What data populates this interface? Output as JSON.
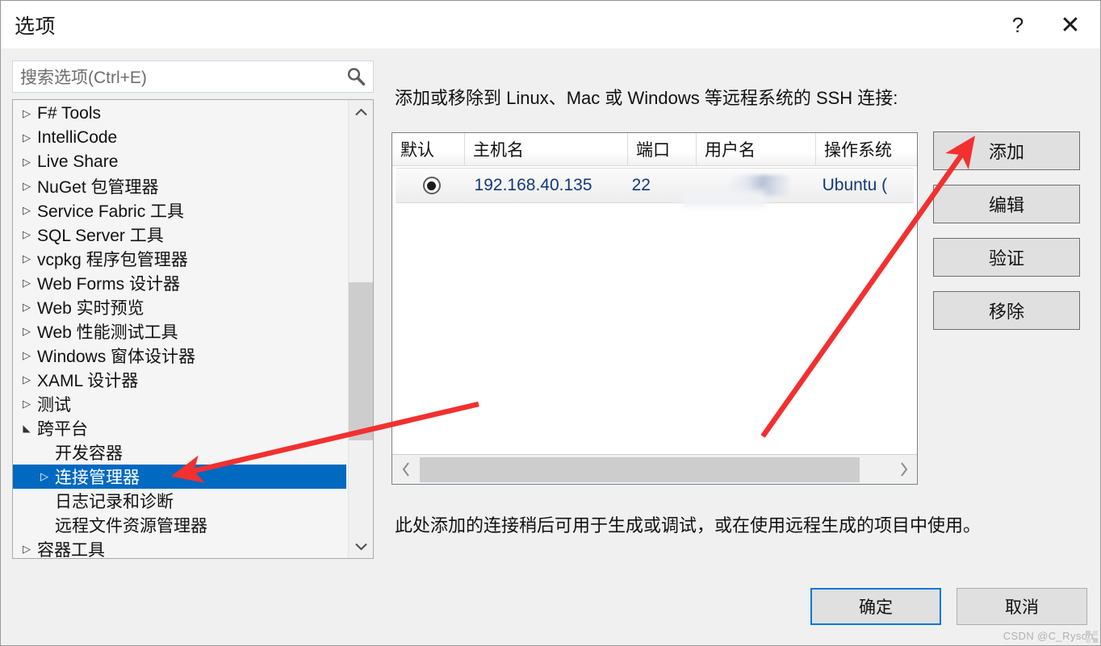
{
  "window": {
    "title": "选项",
    "help_label": "?",
    "close_label": "✕"
  },
  "search": {
    "placeholder": "搜索选项(Ctrl+E)",
    "icon": "search-icon"
  },
  "tree": {
    "items": [
      {
        "label": "F# Tools",
        "expandable": true,
        "expanded": false,
        "level": 0,
        "selected": false
      },
      {
        "label": "IntelliCode",
        "expandable": true,
        "expanded": false,
        "level": 0,
        "selected": false
      },
      {
        "label": "Live Share",
        "expandable": true,
        "expanded": false,
        "level": 0,
        "selected": false
      },
      {
        "label": "NuGet 包管理器",
        "expandable": true,
        "expanded": false,
        "level": 0,
        "selected": false
      },
      {
        "label": "Service Fabric 工具",
        "expandable": true,
        "expanded": false,
        "level": 0,
        "selected": false
      },
      {
        "label": "SQL Server 工具",
        "expandable": true,
        "expanded": false,
        "level": 0,
        "selected": false
      },
      {
        "label": "vcpkg 程序包管理器",
        "expandable": true,
        "expanded": false,
        "level": 0,
        "selected": false
      },
      {
        "label": "Web Forms 设计器",
        "expandable": true,
        "expanded": false,
        "level": 0,
        "selected": false
      },
      {
        "label": "Web 实时预览",
        "expandable": true,
        "expanded": false,
        "level": 0,
        "selected": false
      },
      {
        "label": "Web 性能测试工具",
        "expandable": true,
        "expanded": false,
        "level": 0,
        "selected": false
      },
      {
        "label": "Windows 窗体设计器",
        "expandable": true,
        "expanded": false,
        "level": 0,
        "selected": false
      },
      {
        "label": "XAML 设计器",
        "expandable": true,
        "expanded": false,
        "level": 0,
        "selected": false
      },
      {
        "label": "测试",
        "expandable": true,
        "expanded": false,
        "level": 0,
        "selected": false
      },
      {
        "label": "跨平台",
        "expandable": true,
        "expanded": true,
        "level": 0,
        "selected": false
      },
      {
        "label": "开发容器",
        "expandable": false,
        "expanded": false,
        "level": 1,
        "selected": false
      },
      {
        "label": "连接管理器",
        "expandable": true,
        "expanded": false,
        "level": 1,
        "selected": true
      },
      {
        "label": "日志记录和诊断",
        "expandable": false,
        "expanded": false,
        "level": 1,
        "selected": false
      },
      {
        "label": "远程文件资源管理器",
        "expandable": false,
        "expanded": false,
        "level": 1,
        "selected": false
      },
      {
        "label": "容器工具",
        "expandable": true,
        "expanded": false,
        "level": 0,
        "selected": false
      }
    ],
    "scrollbar": {
      "up_icon": "chevron-up-icon",
      "down_icon": "chevron-down-icon"
    }
  },
  "pane": {
    "description": "添加或移除到 Linux、Mac 或 Windows 等远程系统的 SSH 连接:",
    "footer_note": "此处添加的连接稍后可用于生成或调试，或在使用远程生成的项目中使用。"
  },
  "table": {
    "columns": [
      "默认",
      "主机名",
      "端口",
      "用户名",
      "操作系统"
    ],
    "rows": [
      {
        "default_selected": true,
        "hostname": "192.168.40.135",
        "port": "22",
        "username": "",
        "os": "Ubuntu ("
      }
    ],
    "hscroll": {
      "left_icon": "chevron-left-icon",
      "right_icon": "chevron-right-icon"
    }
  },
  "side_buttons": [
    {
      "label": "添加"
    },
    {
      "label": "编辑"
    },
    {
      "label": "验证"
    },
    {
      "label": "移除"
    }
  ],
  "footer_buttons": [
    {
      "label": "确定",
      "default": true
    },
    {
      "label": "取消",
      "default": false
    }
  ],
  "watermark": "CSDN @C_Ryson",
  "colors": {
    "selection_blue": "#0069c0",
    "link_blue": "#13397a",
    "accent": "#0078d7",
    "annotation_red": "#f23030",
    "dialog_bg": "#f0f0f0"
  }
}
